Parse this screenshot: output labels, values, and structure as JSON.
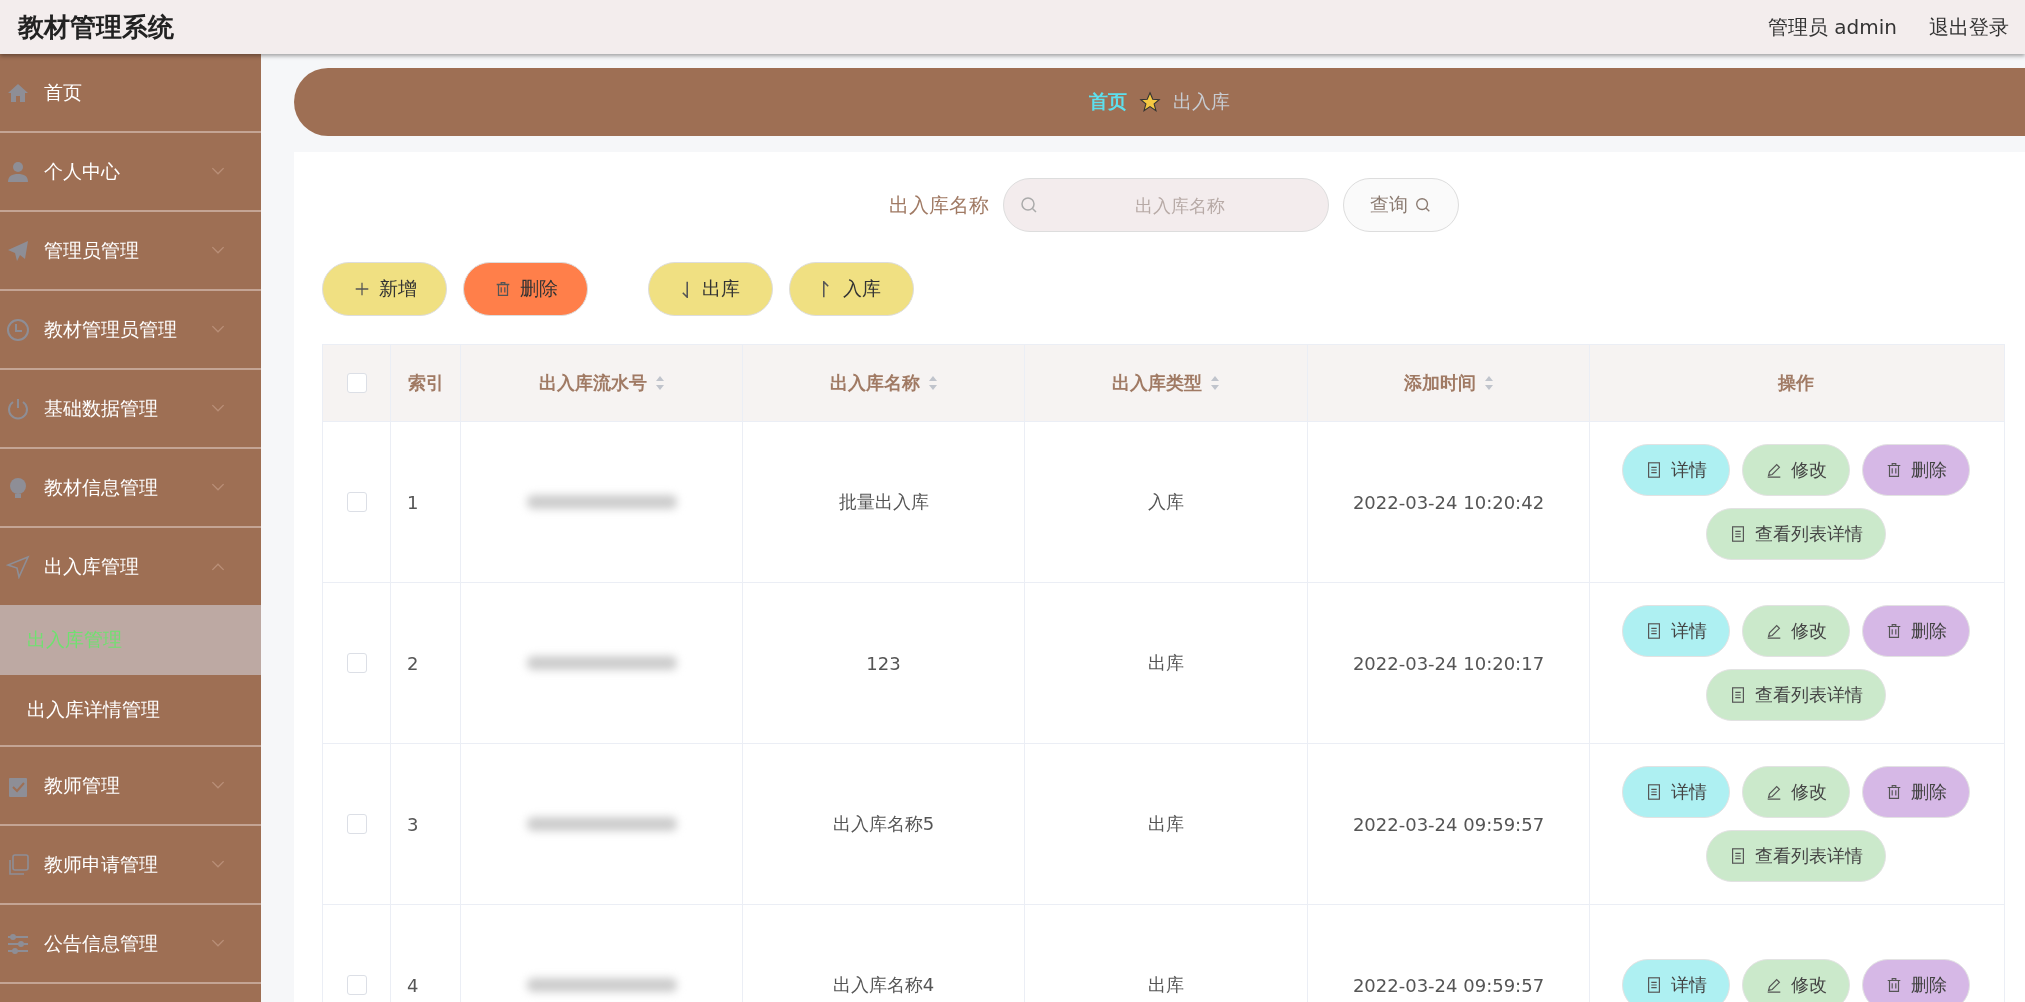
{
  "header": {
    "title": "教材管理系统",
    "user": "管理员 admin",
    "logout": "退出登录"
  },
  "sidebar": {
    "items": [
      {
        "label": "首页"
      },
      {
        "label": "个人中心",
        "expanded": false
      },
      {
        "label": "管理员管理",
        "expanded": false
      },
      {
        "label": "教材管理员管理",
        "expanded": false
      },
      {
        "label": "基础数据管理",
        "expanded": false
      },
      {
        "label": "教材信息管理",
        "expanded": false
      },
      {
        "label": "出入库管理",
        "expanded": true,
        "children": [
          {
            "label": "出入库管理",
            "selected": true
          },
          {
            "label": "出入库详情管理",
            "selected": false
          }
        ]
      },
      {
        "label": "教师管理",
        "expanded": false
      },
      {
        "label": "教师申请管理",
        "expanded": false
      },
      {
        "label": "公告信息管理",
        "expanded": false
      }
    ]
  },
  "breadcrumb": {
    "home": "首页",
    "current": "出入库"
  },
  "search": {
    "label": "出入库名称",
    "placeholder": "出入库名称",
    "button": "查询"
  },
  "toolbar": [
    {
      "label": "新增",
      "kind": "add"
    },
    {
      "label": "删除",
      "kind": "delete"
    },
    {
      "label": "出库",
      "kind": "out"
    },
    {
      "label": "入库",
      "kind": "in"
    }
  ],
  "table": {
    "all_checked": false,
    "columns": [
      {
        "label": "索引",
        "sortable": false
      },
      {
        "label": "出入库流水号",
        "sortable": true
      },
      {
        "label": "出入库名称",
        "sortable": true
      },
      {
        "label": "出入库类型",
        "sortable": true
      },
      {
        "label": "添加时间",
        "sortable": true
      },
      {
        "label": "操作",
        "sortable": false
      }
    ],
    "rows": [
      {
        "checked": false,
        "index": "1",
        "name": "批量出入库",
        "type": "入库",
        "time": "2022-03-24 10:20:42",
        "actions": [
          {
            "label": "详情",
            "kind": "detail"
          },
          {
            "label": "修改",
            "kind": "edit"
          },
          {
            "label": "删除",
            "kind": "delete"
          },
          {
            "label": "查看列表详情",
            "kind": "list"
          }
        ]
      },
      {
        "checked": false,
        "index": "2",
        "name": "123",
        "type": "出库",
        "time": "2022-03-24 10:20:17",
        "actions": [
          {
            "label": "详情",
            "kind": "detail"
          },
          {
            "label": "修改",
            "kind": "edit"
          },
          {
            "label": "删除",
            "kind": "delete"
          },
          {
            "label": "查看列表详情",
            "kind": "list"
          }
        ]
      },
      {
        "checked": false,
        "index": "3",
        "name": "出入库名称5",
        "type": "出库",
        "time": "2022-03-24 09:59:57",
        "actions": [
          {
            "label": "详情",
            "kind": "detail"
          },
          {
            "label": "修改",
            "kind": "edit"
          },
          {
            "label": "删除",
            "kind": "delete"
          },
          {
            "label": "查看列表详情",
            "kind": "list"
          }
        ]
      },
      {
        "checked": false,
        "index": "4",
        "name": "出入库名称4",
        "type": "出库",
        "time": "2022-03-24 09:59:57",
        "actions": [
          {
            "label": "详情",
            "kind": "detail"
          },
          {
            "label": "修改",
            "kind": "edit"
          },
          {
            "label": "删除",
            "kind": "delete"
          }
        ]
      }
    ]
  }
}
